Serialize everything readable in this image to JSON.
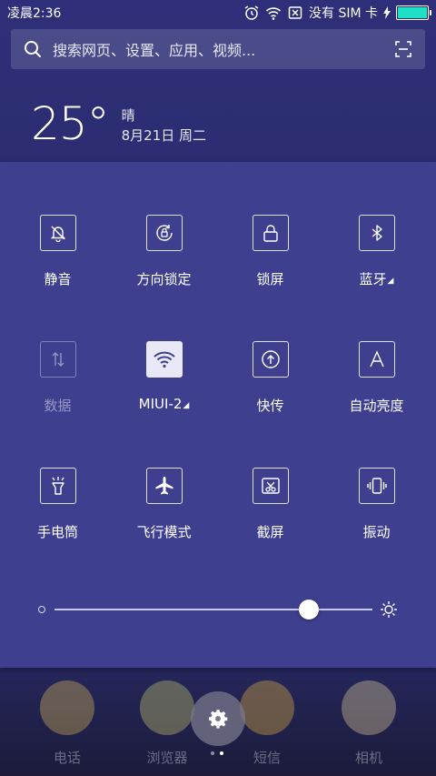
{
  "status": {
    "time": "凌晨2:36",
    "no_sim": "没有 SIM 卡"
  },
  "search": {
    "placeholder": "搜索网页、设置、应用、视频..."
  },
  "weather": {
    "temp": "25°",
    "condition": "晴",
    "date": "8月21日 周二"
  },
  "quick_settings": [
    {
      "label": "静音",
      "icon": "bell-off-icon",
      "state": "off"
    },
    {
      "label": "方向锁定",
      "icon": "rotation-lock-icon",
      "state": "off"
    },
    {
      "label": "锁屏",
      "icon": "lock-icon",
      "state": "off"
    },
    {
      "label": "蓝牙",
      "icon": "bluetooth-icon",
      "state": "off",
      "has_menu": true
    },
    {
      "label": "数据",
      "icon": "data-arrows-icon",
      "state": "disabled"
    },
    {
      "label": "MIUI-2",
      "icon": "wifi-icon",
      "state": "on",
      "has_menu": true
    },
    {
      "label": "快传",
      "icon": "share-upload-icon",
      "state": "off"
    },
    {
      "label": "自动亮度",
      "icon": "auto-brightness-icon",
      "state": "off"
    },
    {
      "label": "手电筒",
      "icon": "flashlight-icon",
      "state": "off"
    },
    {
      "label": "飞行模式",
      "icon": "airplane-icon",
      "state": "off"
    },
    {
      "label": "截屏",
      "icon": "screenshot-icon",
      "state": "off"
    },
    {
      "label": "振动",
      "icon": "vibrate-icon",
      "state": "off"
    }
  ],
  "brightness": {
    "level": 0.8
  },
  "dock": {
    "apps": [
      {
        "name": "电话",
        "icon": "phone-icon",
        "color": "#e8c75a"
      },
      {
        "name": "浏览器",
        "icon": "browser-icon",
        "color": "#d8d870"
      },
      {
        "name": "短信",
        "icon": "message-icon",
        "color": "#f0c040"
      },
      {
        "name": "相机",
        "icon": "camera-icon",
        "color": "#f0e0a0"
      }
    ]
  },
  "colors": {
    "panel": "#3e3f8f",
    "accent": "#1ee0c8"
  }
}
